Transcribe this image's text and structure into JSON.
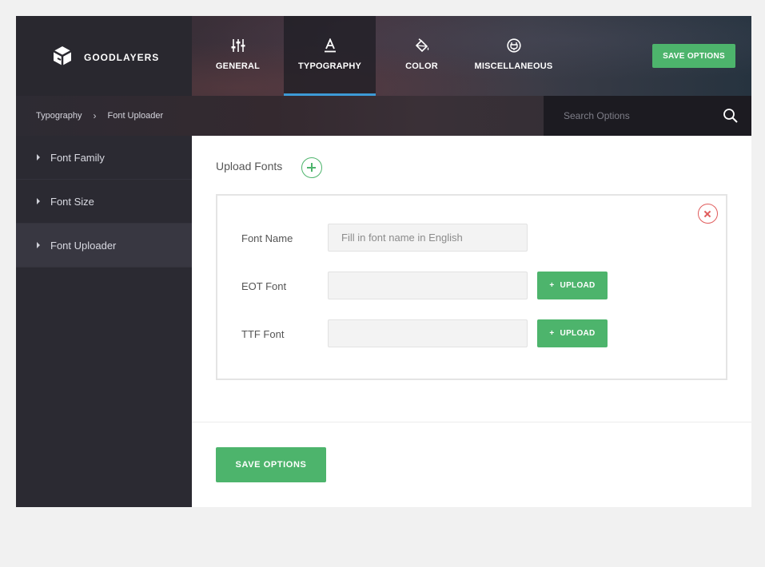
{
  "brand": {
    "name": "GOODLAYERS",
    "logo_icon": "goodlayers-logo-icon"
  },
  "nav": {
    "tabs": [
      {
        "label": "GENERAL",
        "icon": "sliders-icon",
        "active": false
      },
      {
        "label": "TYPOGRAPHY",
        "icon": "typography-icon",
        "active": true
      },
      {
        "label": "COLOR",
        "icon": "paint-bucket-icon",
        "active": false
      },
      {
        "label": "MISCELLANEOUS",
        "icon": "plug-icon",
        "active": false
      }
    ],
    "save_label": "SAVE OPTIONS"
  },
  "breadcrumb": {
    "items": [
      "Typography",
      "Font Uploader"
    ],
    "separator": "›"
  },
  "search": {
    "placeholder": "Search Options",
    "value": ""
  },
  "sidebar": {
    "items": [
      {
        "label": "Font Family",
        "active": false
      },
      {
        "label": "Font Size",
        "active": false
      },
      {
        "label": "Font Uploader",
        "active": true
      }
    ]
  },
  "main": {
    "section_title": "Upload Fonts",
    "font_card": {
      "font_name": {
        "label": "Font Name",
        "placeholder": "Fill in font name in English",
        "value": ""
      },
      "eot_font": {
        "label": "EOT Font",
        "value": "",
        "button_label": "UPLOAD",
        "button_prefix": "+"
      },
      "ttf_font": {
        "label": "TTF Font",
        "value": "",
        "button_label": "UPLOAD",
        "button_prefix": "+"
      }
    },
    "save_label": "SAVE OPTIONS"
  },
  "colors": {
    "accent_green": "#4db46c",
    "active_tab_underline": "#3d9ad6",
    "remove_red": "#e05b5b",
    "sidebar_bg": "#2b2a32",
    "page_bg": "#f1f1f1"
  }
}
